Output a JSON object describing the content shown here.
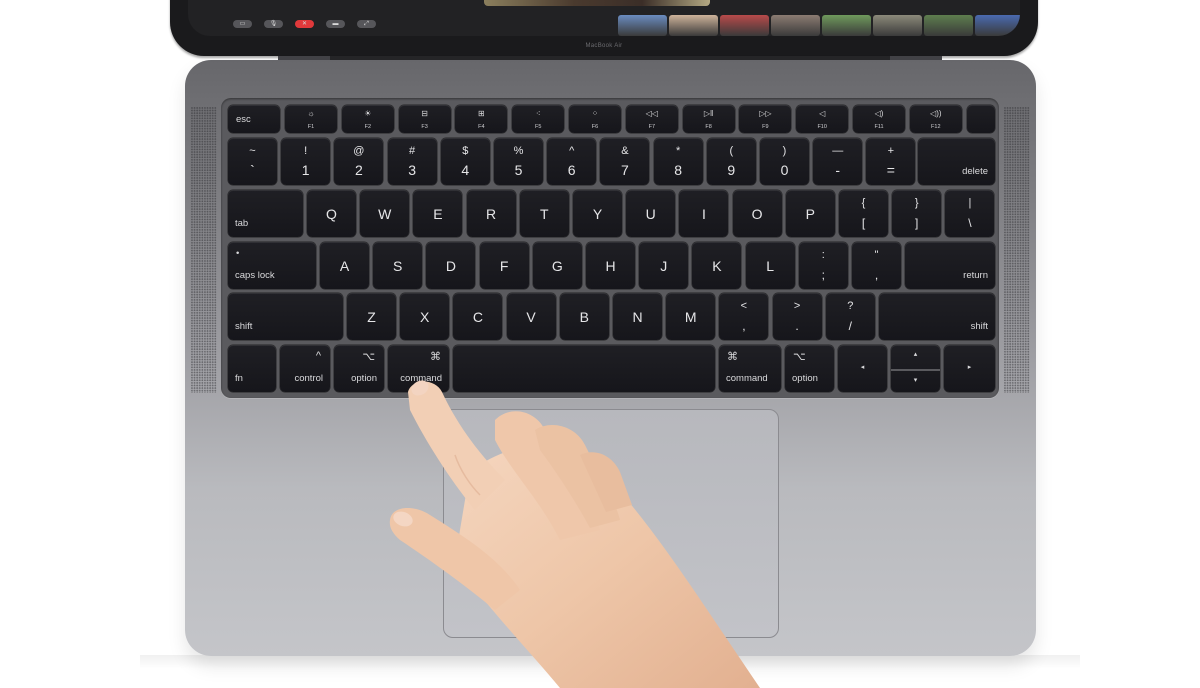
{
  "device": {
    "model_label": "MacBook Air",
    "colors": {
      "lid": "#1a1a1c",
      "screen": "#222224",
      "deck_top": "#67676b",
      "deck_bottom": "#c4c5c9",
      "key": "#1a1a1f",
      "key_legend": "#e6e6e8",
      "end_call": "#e0393b",
      "trackpad": "#bdbec3",
      "skin": "#efc9ad"
    }
  },
  "screen": {
    "call_controls": [
      {
        "name": "screen-share-icon",
        "glyph": "▭"
      },
      {
        "name": "microphone-icon",
        "glyph": "🎙"
      },
      {
        "name": "end-call-icon",
        "glyph": "✕"
      },
      {
        "name": "camera-icon",
        "glyph": "▬"
      },
      {
        "name": "effects-icon",
        "glyph": "⤢"
      }
    ],
    "participant_thumbnails": [
      {
        "color": "#6a8cc0"
      },
      {
        "color": "#cdb39a"
      },
      {
        "color": "#b84a4a"
      },
      {
        "color": "#8c7c72"
      },
      {
        "color": "#6f9a5c"
      },
      {
        "color": "#8c8a7a"
      },
      {
        "color": "#5e7e4e"
      },
      {
        "color": "#4a6ab0"
      }
    ]
  },
  "keyboard": {
    "function_row": {
      "esc": "esc",
      "keys": [
        {
          "label": "F1",
          "icon": "☼",
          "icon_name": "brightness-down-icon"
        },
        {
          "label": "F2",
          "icon": "☀",
          "icon_name": "brightness-up-icon"
        },
        {
          "label": "F3",
          "icon": "⊟",
          "icon_name": "mission-control-icon"
        },
        {
          "label": "F4",
          "icon": "⊞",
          "icon_name": "launchpad-icon"
        },
        {
          "label": "F5",
          "icon": "⁖",
          "icon_name": "keyboard-light-down-icon"
        },
        {
          "label": "F6",
          "icon": "⁘",
          "icon_name": "keyboard-light-up-icon"
        },
        {
          "label": "F7",
          "icon": "◁◁",
          "icon_name": "rewind-icon"
        },
        {
          "label": "F8",
          "icon": "▷‖",
          "icon_name": "play-pause-icon"
        },
        {
          "label": "F9",
          "icon": "▷▷",
          "icon_name": "fast-forward-icon"
        },
        {
          "label": "F10",
          "icon": "◁",
          "icon_name": "mute-icon"
        },
        {
          "label": "F11",
          "icon": "◁)",
          "icon_name": "volume-down-icon"
        },
        {
          "label": "F12",
          "icon": "◁))",
          "icon_name": "volume-up-icon"
        }
      ],
      "touch_id": ""
    },
    "number_row": [
      {
        "top": "~",
        "bottom": "`"
      },
      {
        "top": "!",
        "bottom": "1"
      },
      {
        "top": "@",
        "bottom": "2"
      },
      {
        "top": "#",
        "bottom": "3"
      },
      {
        "top": "$",
        "bottom": "4"
      },
      {
        "top": "%",
        "bottom": "5"
      },
      {
        "top": "^",
        "bottom": "6"
      },
      {
        "top": "&",
        "bottom": "7"
      },
      {
        "top": "*",
        "bottom": "8"
      },
      {
        "top": "(",
        "bottom": "9"
      },
      {
        "top": ")",
        "bottom": "0"
      },
      {
        "top": "—",
        "bottom": "-"
      },
      {
        "top": "+",
        "bottom": "="
      }
    ],
    "delete": "delete",
    "tab": "tab",
    "qwerty_row": [
      "Q",
      "W",
      "E",
      "R",
      "T",
      "Y",
      "U",
      "I",
      "O",
      "P"
    ],
    "qwerty_row_symbols": [
      {
        "top": "{",
        "bottom": "["
      },
      {
        "top": "}",
        "bottom": "]"
      },
      {
        "top": "|",
        "bottom": "\\"
      }
    ],
    "caps_lock": "caps lock",
    "caps_lock_indicator": "•",
    "home_row": [
      "A",
      "S",
      "D",
      "F",
      "G",
      "H",
      "J",
      "K",
      "L"
    ],
    "home_row_symbols": [
      {
        "top": ":",
        "bottom": ";"
      },
      {
        "top": "\"",
        "bottom": ","
      }
    ],
    "return": "return",
    "shift_left": "shift",
    "bottom_letter_row": [
      "Z",
      "X",
      "C",
      "V",
      "B",
      "N",
      "M"
    ],
    "bottom_row_symbols": [
      {
        "top": "<",
        "bottom": ","
      },
      {
        "top": ">",
        "bottom": "."
      },
      {
        "top": "?",
        "bottom": "/"
      }
    ],
    "shift_right": "shift",
    "modifier_row": {
      "fn": "fn",
      "control": {
        "label": "control",
        "glyph": "^"
      },
      "option_left": {
        "label": "option",
        "glyph": "⌥"
      },
      "command_left": {
        "label": "command",
        "glyph": "⌘"
      },
      "space": "",
      "command_right": {
        "label": "command",
        "glyph": "⌘"
      },
      "option_right": {
        "label": "option",
        "glyph": "⌥"
      },
      "arrow_left": "◂",
      "arrow_up": "▴",
      "arrow_down": "▾",
      "arrow_right": "▸"
    }
  },
  "scene": {
    "hand_gesture": "index finger pressing left command key"
  }
}
